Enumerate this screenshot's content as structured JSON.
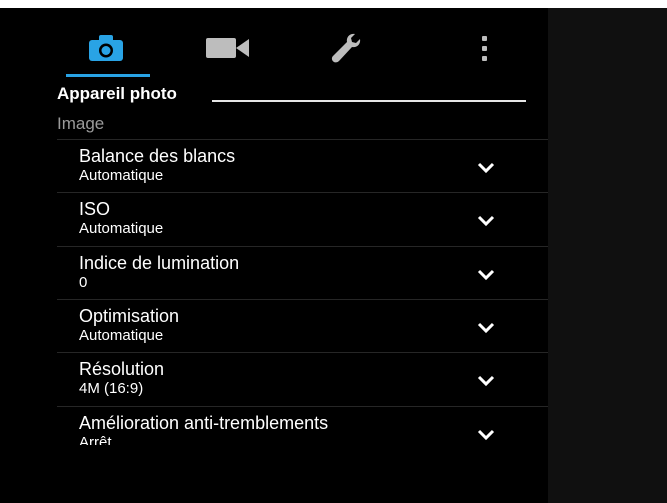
{
  "tabs": [
    {
      "icon": "camera-icon",
      "selected": true
    },
    {
      "icon": "video-camera-icon",
      "selected": false
    },
    {
      "icon": "wrench-icon",
      "selected": false
    },
    {
      "icon": "more-vertical-icon",
      "selected": false
    }
  ],
  "colors": {
    "accent": "#29a3e5",
    "background": "#000000",
    "text": "#ffffff",
    "muted": "#9a9a9a"
  },
  "page_title": "Appareil photo",
  "section_header": "Image",
  "settings": [
    {
      "title": "Balance des blancs",
      "value": "Automatique",
      "icon": "chevron-down-icon"
    },
    {
      "title": "ISO",
      "value": "Automatique",
      "icon": "chevron-down-icon"
    },
    {
      "title": "Indice de lumination",
      "value": "0",
      "icon": "chevron-down-icon"
    },
    {
      "title": "Optimisation",
      "value": "Automatique",
      "icon": "chevron-down-icon"
    },
    {
      "title": "Résolution",
      "value": "4M (16:9)",
      "icon": "chevron-down-icon"
    },
    {
      "title": "Amélioration anti-tremblements",
      "value": "Arrêt",
      "icon": "chevron-down-icon"
    }
  ]
}
